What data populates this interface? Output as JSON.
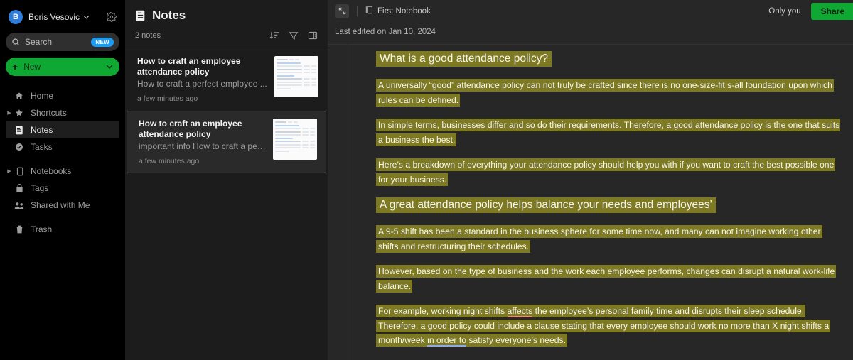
{
  "colors": {
    "brand_green": "#0ea832",
    "badge_blue": "#1d9bf0",
    "highlight_olive": "#7e7a23",
    "grammar_underline": "#f08a7a",
    "style_underline": "#8fa8e8",
    "sidebar_bg": "#000000",
    "list_bg": "#1c1c1c",
    "editor_bg": "#272727"
  },
  "sidebar": {
    "account": {
      "initial": "B",
      "name": "Boris Vesovic",
      "chevron": "⌄"
    },
    "settings_icon": "gear-icon",
    "search": {
      "placeholder": "Search",
      "badge": "NEW",
      "icon": "search-icon"
    },
    "new_button": {
      "label": "New",
      "plus": "+",
      "chevron": "⌄"
    },
    "items": [
      {
        "label": "Home",
        "icon": "home-icon",
        "active": false,
        "disclosure": false
      },
      {
        "label": "Shortcuts",
        "icon": "star-icon",
        "active": false,
        "disclosure": true
      },
      {
        "label": "Notes",
        "icon": "notes-icon",
        "active": true,
        "disclosure": false
      },
      {
        "label": "Tasks",
        "icon": "check-circle-icon",
        "active": false,
        "disclosure": false
      },
      {
        "label": "Notebooks",
        "icon": "notebook-icon",
        "active": false,
        "disclosure": true
      },
      {
        "label": "Tags",
        "icon": "tag-icon",
        "active": false,
        "disclosure": false
      },
      {
        "label": "Shared with Me",
        "icon": "people-icon",
        "active": false,
        "disclosure": false
      },
      {
        "label": "Trash",
        "icon": "trash-icon",
        "active": false,
        "disclosure": false
      }
    ]
  },
  "notes_panel": {
    "title": "Notes",
    "title_icon": "notes-icon",
    "count_label": "2 notes",
    "tools": [
      {
        "name": "sort-icon",
        "label": "Sort"
      },
      {
        "name": "filter-icon",
        "label": "Filter"
      },
      {
        "name": "view-options-icon",
        "label": "View options"
      }
    ],
    "notes": [
      {
        "title": "How to craft an employee attendance policy",
        "snippet": "How to craft a perfect employee ...",
        "time": "a few minutes ago",
        "selected": false
      },
      {
        "title": "How to craft an employee attendance policy",
        "snippet": "important info How to craft a perf...",
        "time": "a few minutes ago",
        "selected": true
      }
    ]
  },
  "editor": {
    "expand_icon": "expand-icon",
    "notebook": {
      "label": "First Notebook",
      "icon": "notebook-icon"
    },
    "only_you_label": "Only you",
    "share_label": "Share",
    "last_edited": "Last edited on Jan 10, 2024",
    "blocks": [
      {
        "type": "heading",
        "runs": [
          {
            "text": "What is a good attendance policy?",
            "style": "highlight"
          }
        ]
      },
      {
        "type": "paragraph",
        "runs": [
          {
            "text": "A universally “good” attendance policy can not truly be crafted since there is no one-size-fit  s-all foundation upon which rules can be defined.",
            "style": "highlight"
          }
        ]
      },
      {
        "type": "paragraph",
        "runs": [
          {
            "text": "In simple terms, businesses differ and so do their requirements. Therefore, a good attendance policy is the one that suits a business the best.",
            "style": "highlight"
          }
        ]
      },
      {
        "type": "paragraph",
        "runs": [
          {
            "text": "Here’s a breakdown of everything your attendance policy should help you with if you want to craft the best possible one for your business.",
            "style": "highlight"
          }
        ]
      },
      {
        "type": "heading",
        "runs": [
          {
            "text": "A great attendance policy helps balance your needs and employees’",
            "style": "highlight"
          }
        ]
      },
      {
        "type": "paragraph",
        "runs": [
          {
            "text": "A 9-5 shift has been a standard in the business sphere for some time now, and many can not imagine working other shifts and restructuring their schedules.",
            "style": "highlight"
          }
        ]
      },
      {
        "type": "paragraph",
        "runs": [
          {
            "text": "However, based on the type of business and the work each employee performs, changes can disrupt a natural work-life balance.",
            "style": "highlight"
          }
        ]
      },
      {
        "type": "paragraph",
        "runs": [
          {
            "text": "For example,  working night shifts  ",
            "style": "highlight"
          },
          {
            "text": "affects",
            "style": "highlight grammar"
          },
          {
            "text": " the employee’s personal family time and disrupts their sleep schedule. Therefore, a good policy could include a clause stating that every employee should work no more than X night shifts a month/week ",
            "style": "highlight"
          },
          {
            "text": "in order to",
            "style": "highlight style-suggestion"
          },
          {
            "text": " satisfy everyone’s needs.",
            "style": "highlight"
          }
        ]
      }
    ]
  }
}
